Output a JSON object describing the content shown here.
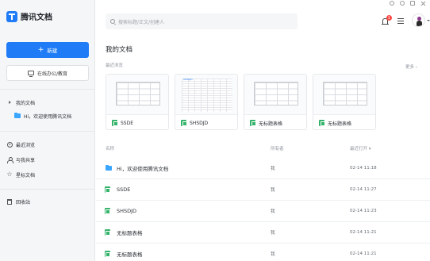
{
  "app": {
    "name": "腾讯文档"
  },
  "sidebar": {
    "new_label": "新建",
    "office_label": "在线办公/教育",
    "items": [
      {
        "label": "我的文档",
        "icon": "caret-right-icon"
      },
      {
        "label": "Hi，欢迎使用腾讯文档",
        "icon": "folder-icon"
      },
      {
        "label": "最近浏览",
        "icon": "clock-icon"
      },
      {
        "label": "与我共享",
        "icon": "person-icon"
      },
      {
        "label": "星标文档",
        "icon": "star-icon"
      },
      {
        "label": "回收站",
        "icon": "trash-icon"
      }
    ]
  },
  "search": {
    "placeholder": "搜索标题/正文/创建人"
  },
  "header": {
    "notification_count": "1"
  },
  "main": {
    "title": "我的文档",
    "recent_label": "最近浏览",
    "more_label": "更多 ›",
    "cards": [
      {
        "name": "SSDE",
        "thumb": "grid"
      },
      {
        "name": "SHSDJD",
        "thumb": "sheet"
      },
      {
        "name": "无标题表格",
        "thumb": "grid"
      },
      {
        "name": "无标题表格",
        "thumb": "grid"
      }
    ],
    "thumb_text": "SHSDJD",
    "columns": {
      "name": "名称",
      "owner": "所有者",
      "time": "最近打开 ▾"
    },
    "rows": [
      {
        "name": "Hi，欢迎使用腾讯文档",
        "type": "folder",
        "owner": "我",
        "time": "02-14 11:18"
      },
      {
        "name": "SSDE",
        "type": "sheet",
        "owner": "我",
        "time": "02-14 11:27"
      },
      {
        "name": "SHSDJD",
        "type": "sheet",
        "owner": "我",
        "time": "02-14 11:23"
      },
      {
        "name": "无标题表格",
        "type": "sheet",
        "owner": "我",
        "time": "02-14 11:21"
      },
      {
        "name": "无标题表格",
        "type": "sheet",
        "owner": "我",
        "time": "02-14 11:21"
      }
    ]
  },
  "colors": {
    "accent": "#1f7cf6",
    "sheet_green": "#34b36b",
    "folder_blue": "#3aa6ff",
    "badge_red": "#f54a45"
  }
}
